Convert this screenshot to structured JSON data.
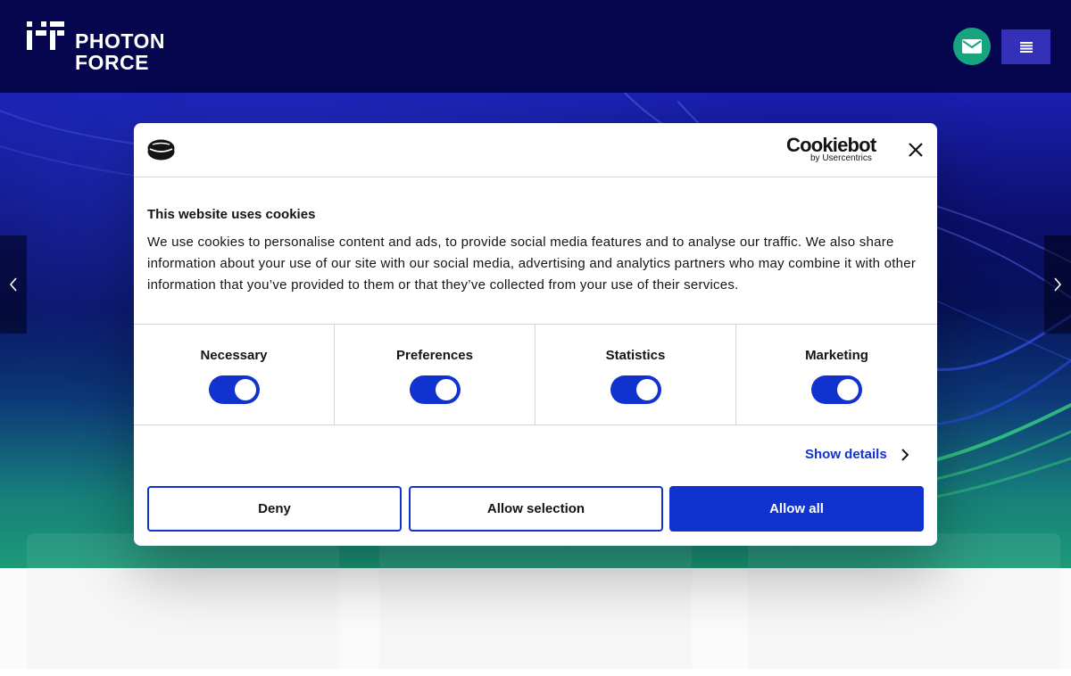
{
  "header": {
    "logo_line1": "PHOTON",
    "logo_line2": "FORCE",
    "mail_icon": "envelope-icon",
    "menu_icon": "hamburger-menu-icon"
  },
  "hero": {
    "prev_icon": "chevron-left-icon",
    "next_icon": "chevron-right-icon"
  },
  "cookie_dialog": {
    "brand_name": "Cookiebot",
    "brand_sub": "by Usercentrics",
    "title": "This website uses cookies",
    "body": "We use cookies to personalise content and ads, to provide social media features and to analyse our traffic. We also share information about your use of our site with our social media, advertising and analytics partners who may combine it with other information that you’ve provided to them or that they’ve collected from your use of their services.",
    "categories": [
      {
        "label": "Necessary",
        "enabled": true
      },
      {
        "label": "Preferences",
        "enabled": true
      },
      {
        "label": "Statistics",
        "enabled": true
      },
      {
        "label": "Marketing",
        "enabled": true
      }
    ],
    "show_details": "Show details",
    "deny": "Deny",
    "allow_selection": "Allow selection",
    "allow_all": "Allow all"
  },
  "colors": {
    "header_bg": "#05064d",
    "accent_blue": "#1032cf",
    "mail_green": "#17a57f",
    "menu_purple": "#3430b8"
  }
}
